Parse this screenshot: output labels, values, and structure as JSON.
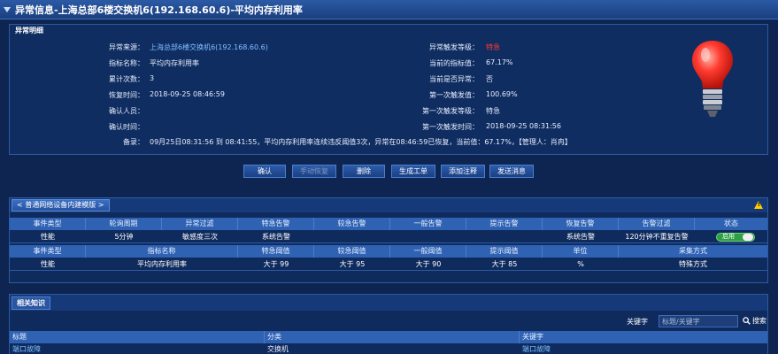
{
  "title": "异常信息-上海总部6楼交换机6(192.168.60.6)-平均内存利用率",
  "panel_title": "异常明细",
  "details": {
    "source_label": "异常来源：",
    "source_value": "上海总部6楼交换机6(192.168.60.6)",
    "level_label": "异常触发等级：",
    "level_value": "特急",
    "metric_label": "指标名称：",
    "metric_value": "平均内存利用率",
    "current_label": "当前的指标值：",
    "current_value": "67.17%",
    "count_label": "累计次数：",
    "count_value": "3",
    "is_abnormal_label": "当前是否异常：",
    "is_abnormal_value": "否",
    "recover_label": "恢复时间：",
    "recover_value": "2018-09-25 08:46:59",
    "first_value_label": "第一次触发值：",
    "first_value_value": "100.69%",
    "confirm_person_label": "确认人员：",
    "confirm_person_value": "",
    "first_level_label": "第一次触发等级：",
    "first_level_value": "特急",
    "confirm_time_label": "确认时间：",
    "confirm_time_value": "",
    "first_time_label": "第一次触发时间：",
    "first_time_value": "2018-09-25 08:31:56",
    "remark_label": "备录：",
    "remark_value": "09月25日08:31:56 到 08:41:55，平均内存利用率连续违反阈值3次，异常在08:46:59已恢复，当前值：67.17%，【管理人：肖冉】"
  },
  "buttons": {
    "confirm": "确认",
    "manual_recover": "手动恢复",
    "delete": "删除",
    "create_ticket": "生成工单",
    "add_note": "添加注释",
    "send_message": "发送消息"
  },
  "template": {
    "tab_label": "< 普通网络设备内建模版 >",
    "head1": [
      "事件类型",
      "轮询周期",
      "异常过滤",
      "特急告警",
      "较急告警",
      "一般告警",
      "提示告警",
      "恢复告警",
      "告警过滤",
      "状态"
    ],
    "row1": [
      "性能",
      "5分钟",
      "敏感度三次",
      "系统告警",
      "",
      "",
      "",
      "系统告警",
      "120分钟不重复告警",
      ""
    ],
    "toggle_label": "启用",
    "head2": [
      "事件类型",
      "指标名称",
      "特急阈值",
      "较急阈值",
      "一般阈值",
      "提示阈值",
      "单位",
      "采集方式"
    ],
    "row2": [
      "性能",
      "平均内存利用率",
      "大于 99",
      "大于 95",
      "大于 90",
      "大于 85",
      "%",
      "特殊方式"
    ]
  },
  "knowledge": {
    "tab_label": "相关知识",
    "keyword_label": "关键字",
    "keyword_placeholder": "标题/关键字",
    "search_label": "搜索",
    "columns": [
      "标题",
      "分类",
      "关键字"
    ],
    "rows": [
      [
        "端口故障",
        "交换机",
        "端口故障"
      ]
    ]
  },
  "colors": {
    "background": "#0d2550",
    "header": "#2f62b3",
    "link": "#7fc1ff",
    "urgent": "#ff3b30",
    "toggle_on": "#2ea043"
  }
}
